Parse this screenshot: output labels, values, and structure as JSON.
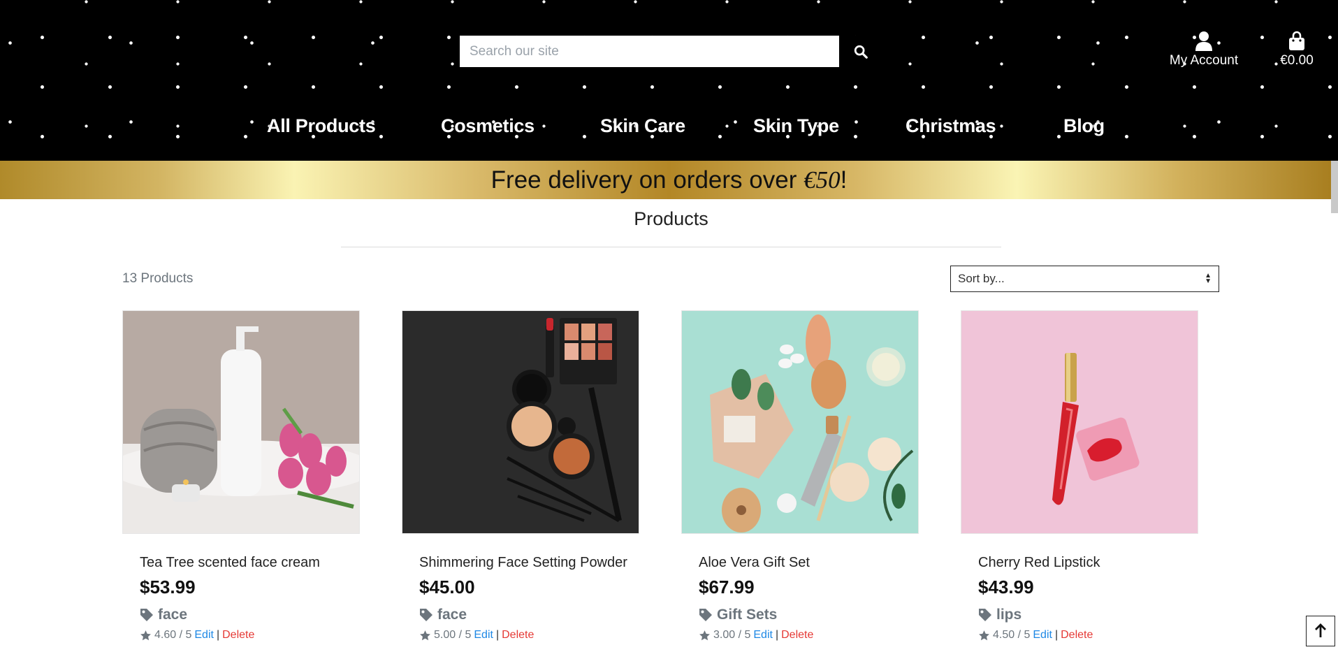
{
  "header": {
    "search_placeholder": "Search our site",
    "account_label": "My Account",
    "bag_total": "€0.00"
  },
  "nav": {
    "items": [
      {
        "label": "All Products"
      },
      {
        "label": "Cosmetics"
      },
      {
        "label": "Skin Care"
      },
      {
        "label": "Skin Type"
      },
      {
        "label": "Christmas"
      },
      {
        "label": "Blog"
      }
    ]
  },
  "banner": {
    "text_before": "Free delivery on orders over ",
    "amount": "€50",
    "text_after": "!"
  },
  "main": {
    "title": "Products",
    "count": "13 Products",
    "sort_label": "Sort by..."
  },
  "products": [
    {
      "name": "Tea Tree scented face cream",
      "price": "$53.99",
      "tag": "face",
      "rating": "4.60 / 5",
      "edit": "Edit",
      "delete": "Delete"
    },
    {
      "name": "Shimmering Face Setting Powder",
      "price": "$45.00",
      "tag": "face",
      "rating": "5.00 / 5",
      "edit": "Edit",
      "delete": "Delete"
    },
    {
      "name": "Aloe Vera Gift Set",
      "price": "$67.99",
      "tag": "Gift Sets",
      "rating": "3.00 / 5",
      "edit": "Edit",
      "delete": "Delete"
    },
    {
      "name": "Cherry Red Lipstick",
      "price": "$43.99",
      "tag": "lips",
      "rating": "4.50 / 5",
      "edit": "Edit",
      "delete": "Delete"
    }
  ],
  "separator": "|",
  "icons": {
    "search": "search-icon",
    "account": "user-icon",
    "bag": "shopping-bag-icon",
    "tag": "tag-icon",
    "star": "star-icon",
    "scroll_top": "arrow-up-icon"
  },
  "colors": {
    "edit": "#1e88e5",
    "delete": "#e53935",
    "banner_gold": "#d3b563"
  }
}
